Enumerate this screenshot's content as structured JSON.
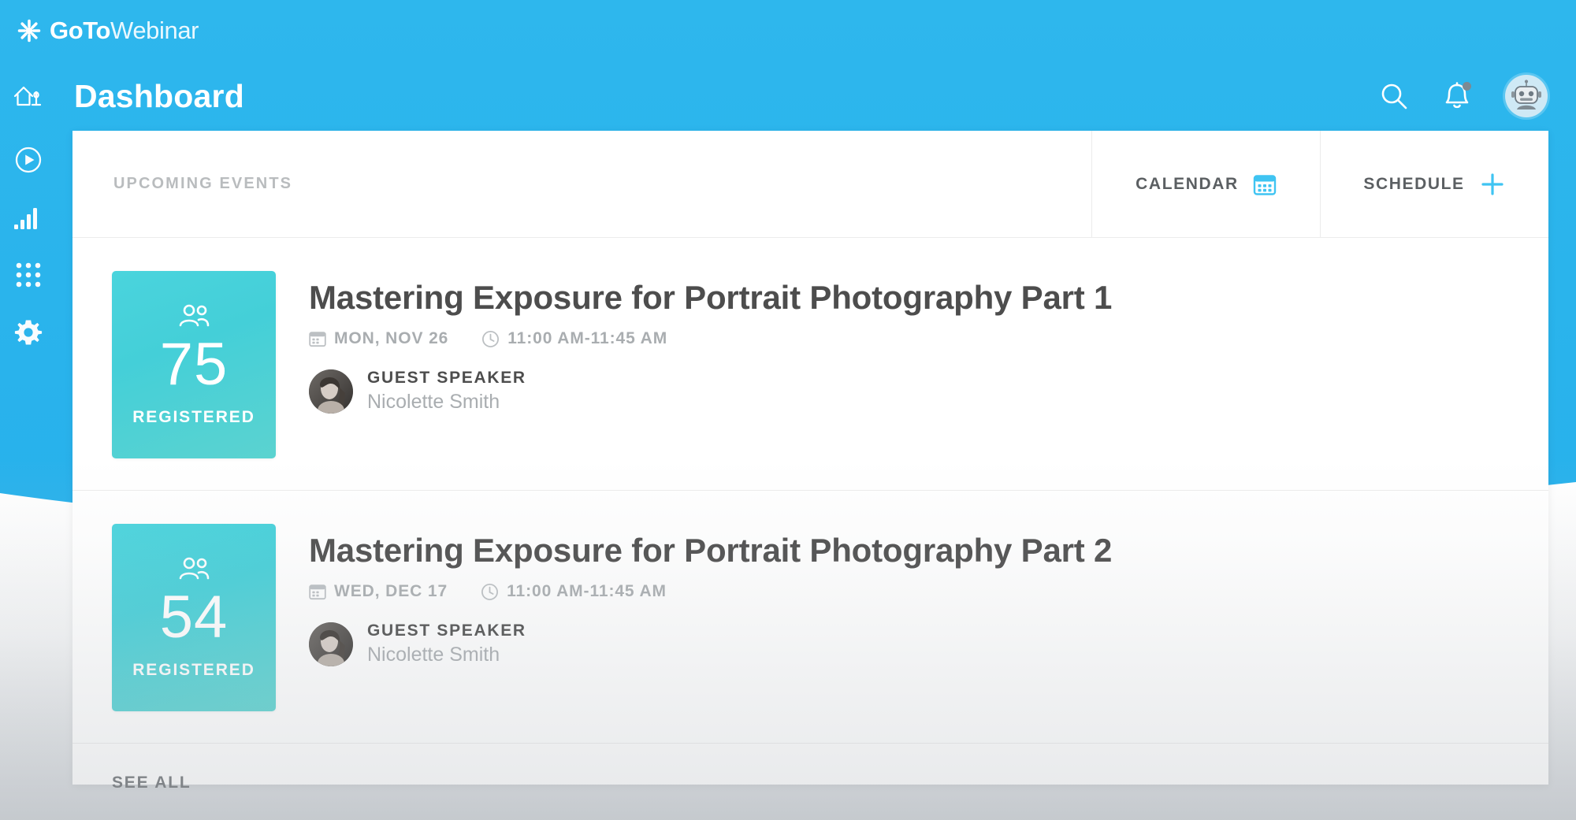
{
  "brand": {
    "name_strong": "GoTo",
    "name_light": "Webinar",
    "logo_icon": "asterisk-snowflake-icon"
  },
  "header": {
    "home_icon": "home-icon",
    "title": "Dashboard",
    "search_icon": "search-icon",
    "notifications_icon": "bell-icon",
    "has_notification_dot": true,
    "avatar_icon": "robot-avatar"
  },
  "sidebar": {
    "items": [
      {
        "name": "recordings",
        "icon": "play-circle-icon"
      },
      {
        "name": "analytics",
        "icon": "bar-chart-icon"
      },
      {
        "name": "apps",
        "icon": "grid-apps-icon"
      },
      {
        "name": "settings",
        "icon": "gear-icon"
      }
    ]
  },
  "panel": {
    "section_label": "UPCOMING EVENTS",
    "actions": [
      {
        "label": "CALENDAR",
        "icon": "calendar-icon"
      },
      {
        "label": "SCHEDULE",
        "icon": "plus-icon"
      }
    ],
    "see_all_label": "SEE ALL"
  },
  "events": [
    {
      "registered_count": "75",
      "registered_caption": "REGISTERED",
      "registered_icon": "people-icon",
      "title": "Mastering Exposure for Portrait Photography Part 1",
      "date_icon": "calendar-icon",
      "date": "MON, NOV 26",
      "time_icon": "clock-icon",
      "time": "11:00 AM-11:45 AM",
      "speaker_role": "GUEST SPEAKER",
      "speaker_name": "Nicolette Smith"
    },
    {
      "registered_count": "54",
      "registered_caption": "REGISTERED",
      "registered_icon": "people-icon",
      "title": "Mastering Exposure for Portrait Photography Part 2",
      "date_icon": "calendar-icon",
      "date": "WED, DEC 17",
      "time_icon": "clock-icon",
      "time": "11:00 AM-11:45 AM",
      "speaker_role": "GUEST SPEAKER",
      "speaker_name": "Nicolette Smith"
    }
  ],
  "colors": {
    "brand_blue": "#29b3ec",
    "tile_teal": "#45d0d9",
    "accent_blue": "#38c0f0",
    "text_dark": "#4d4d4d",
    "text_muted": "#a9adb0"
  }
}
